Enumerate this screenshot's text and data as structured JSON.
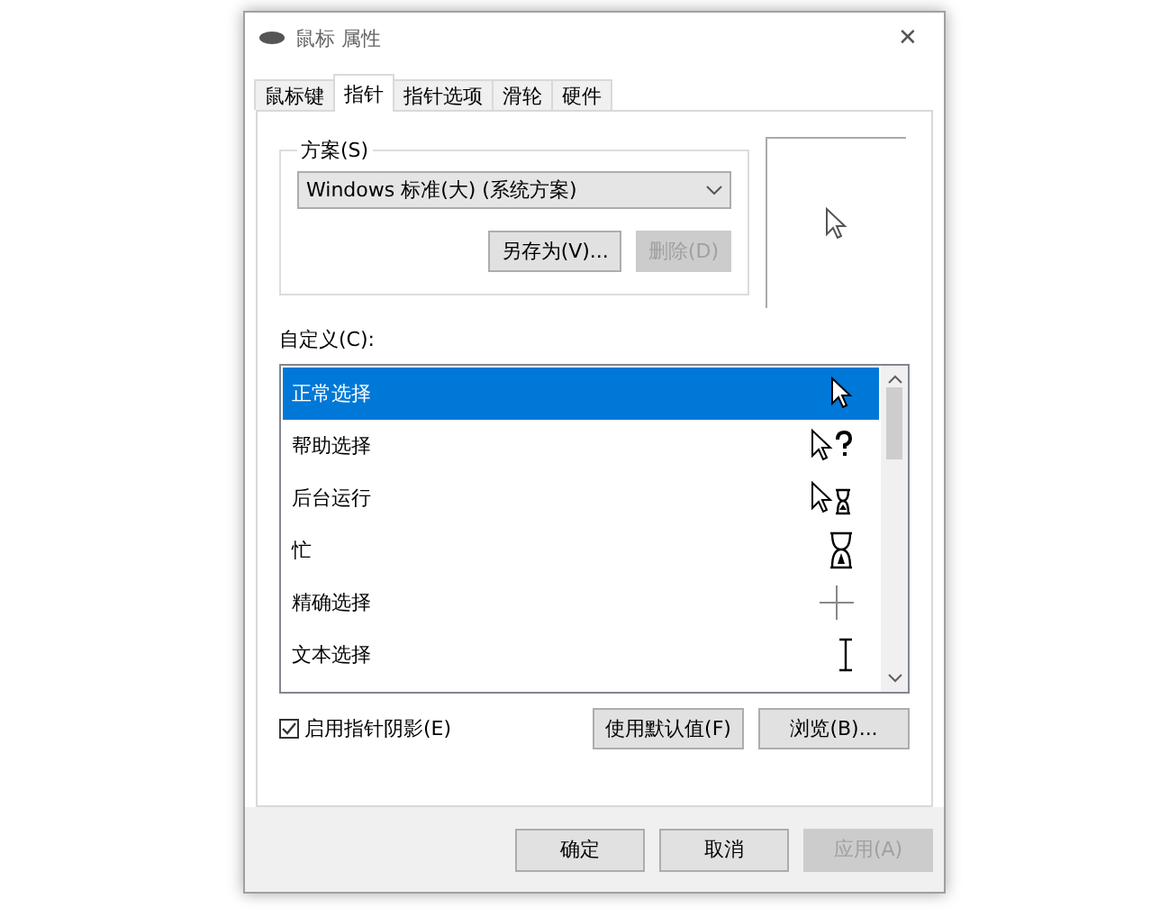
{
  "window": {
    "title": "鼠标 属性",
    "close": "✕"
  },
  "tabs": [
    {
      "label": "鼠标键",
      "selected": false
    },
    {
      "label": "指针",
      "selected": true
    },
    {
      "label": "指针选项",
      "selected": false
    },
    {
      "label": "滑轮",
      "selected": false
    },
    {
      "label": "硬件",
      "selected": false
    }
  ],
  "scheme": {
    "legend": "方案(S)",
    "value": "Windows 标准(大) (系统方案)",
    "buttons": [
      {
        "label": "另存为(V)...",
        "disabled": false
      },
      {
        "label": "删除(D)",
        "disabled": true
      }
    ]
  },
  "customize": {
    "label": "自定义(C):",
    "items": [
      {
        "name": "正常选择",
        "kind": "arrow",
        "selected": true
      },
      {
        "name": "帮助选择",
        "kind": "help",
        "selected": false
      },
      {
        "name": "后台运行",
        "kind": "working",
        "selected": false
      },
      {
        "name": "忙",
        "kind": "busy",
        "selected": false
      },
      {
        "name": "精确选择",
        "kind": "precision",
        "selected": false
      },
      {
        "name": "文本选择",
        "kind": "text",
        "selected": false
      }
    ]
  },
  "shadow": {
    "label": "启用指针阴影(E)",
    "checked": true
  },
  "list_buttons": [
    {
      "label": "使用默认值(F)",
      "disabled": false
    },
    {
      "label": "浏览(B)...",
      "disabled": false
    }
  ],
  "footer_buttons": [
    {
      "label": "确定",
      "disabled": false
    },
    {
      "label": "取消",
      "disabled": false
    },
    {
      "label": "应用(A)",
      "disabled": true
    }
  ]
}
